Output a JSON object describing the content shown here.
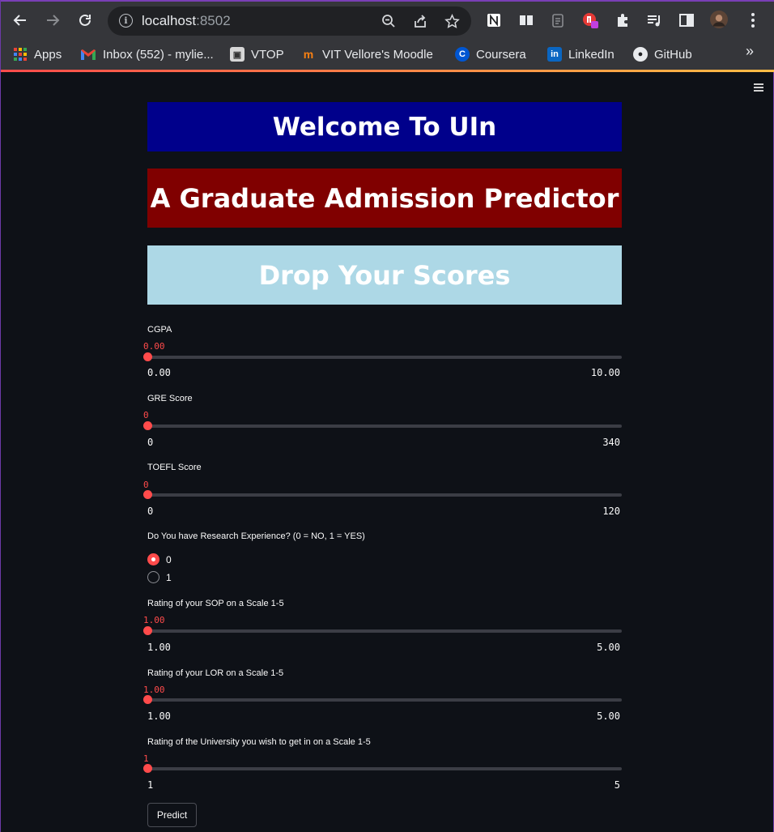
{
  "browser": {
    "url_host": "localhost",
    "url_port": ":8502",
    "bookmarks": [
      {
        "label": "Apps",
        "icon": "apps-grid-icon"
      },
      {
        "label": "Inbox (552) - mylie...",
        "icon": "gmail-icon"
      },
      {
        "label": "VTOP",
        "icon": "vtop-icon"
      },
      {
        "label": "VIT Vellore's Moodle",
        "icon": "moodle-icon"
      },
      {
        "label": "Coursera",
        "icon": "coursera-icon"
      },
      {
        "label": "LinkedIn",
        "icon": "linkedin-icon"
      },
      {
        "label": "GitHub",
        "icon": "github-icon"
      }
    ],
    "more_bookmarks": "»"
  },
  "app": {
    "banner_welcome": "Welcome To UIn",
    "banner_title": "A Graduate Admission Predictor",
    "banner_scores": "Drop Your Scores",
    "sliders": [
      {
        "label": "CGPA",
        "value": "0.00",
        "min": "0.00",
        "max": "10.00",
        "fraction": 0
      },
      {
        "label": "GRE Score",
        "value": "0",
        "min": "0",
        "max": "340",
        "fraction": 0
      },
      {
        "label": "TOEFL Score",
        "value": "0",
        "min": "0",
        "max": "120",
        "fraction": 0
      },
      {
        "label": "Rating of your SOP on a Scale 1-5",
        "value": "1.00",
        "min": "1.00",
        "max": "5.00",
        "fraction": 0
      },
      {
        "label": "Rating of your LOR on a Scale 1-5",
        "value": "1.00",
        "min": "1.00",
        "max": "5.00",
        "fraction": 0
      },
      {
        "label": "Rating of the University you wish to get in on a Scale 1-5",
        "value": "1",
        "min": "1",
        "max": "5",
        "fraction": 0
      }
    ],
    "research": {
      "label": "Do You have Research Experience? (0 = NO, 1 = YES)",
      "options": [
        "0",
        "1"
      ],
      "selected": "0"
    },
    "predict_label": "Predict"
  },
  "colors": {
    "accent": "#ff4b4b",
    "banner_welcome_bg": "#00008b",
    "banner_title_bg": "#800000",
    "banner_scores_bg": "#add8e6",
    "background": "#0e1117"
  }
}
